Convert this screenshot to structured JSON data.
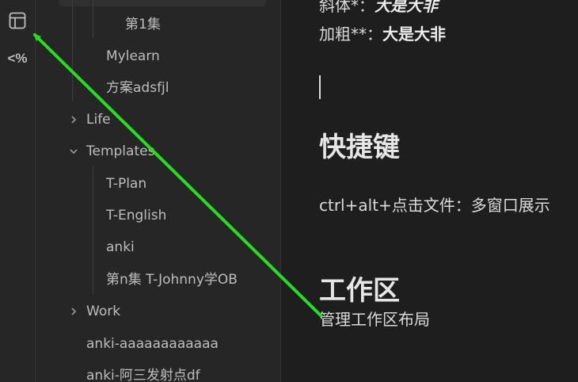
{
  "ribbon": {
    "layout_icon": "layout-icon",
    "template_label": "<%"
  },
  "sidebar": {
    "items": [
      {
        "label": "第1集"
      },
      {
        "label": "Mylearn"
      },
      {
        "label": "方案adsfjl"
      },
      {
        "label": "Life"
      },
      {
        "label": "Templates"
      },
      {
        "label": "T-Plan"
      },
      {
        "label": "T-English"
      },
      {
        "label": "anki"
      },
      {
        "label": "第n集 T-Johnny学OB"
      },
      {
        "label": "Work"
      },
      {
        "label": "anki-aaaaaaaaaaaa"
      },
      {
        "label": "anki-阿三发射点df"
      }
    ]
  },
  "editor": {
    "italic_line": {
      "prefix": "斜体*：",
      "text": "大是大非"
    },
    "bold_line": {
      "prefix": "加粗**：",
      "text": "大是大非"
    },
    "heading1": "快捷键",
    "shortcut_line": "ctrl+alt+点击文件：多窗口展示",
    "heading2": "工作区",
    "workspace_line": "管理工作区布局"
  },
  "annotation": {
    "arrow_color": "#22e01b"
  }
}
